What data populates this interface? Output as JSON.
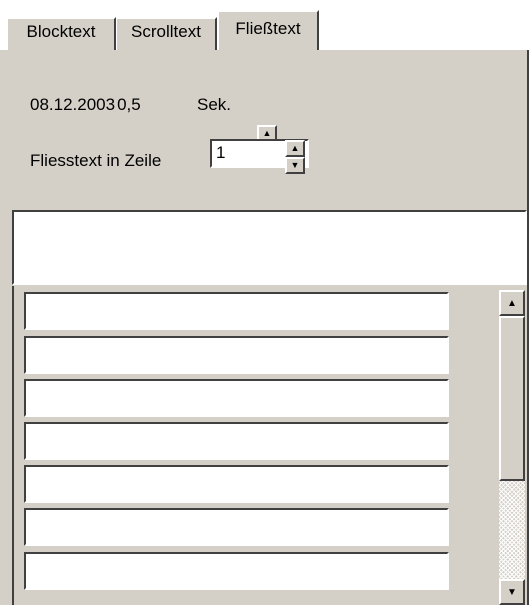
{
  "tabs": [
    {
      "label": "Blocktext"
    },
    {
      "label": "Scrolltext"
    },
    {
      "label": "Fließtext",
      "active": true
    }
  ],
  "settings": {
    "date": "08.12.2003",
    "seconds_value": "0,5",
    "seconds_unit": "Sek.",
    "line_label": "Fliesstext in Zeile",
    "line_value": "1"
  },
  "text_fields": [
    {
      "value": ""
    },
    {
      "value": ""
    },
    {
      "value": ""
    },
    {
      "value": ""
    },
    {
      "value": ""
    },
    {
      "value": ""
    },
    {
      "value": ""
    }
  ],
  "icons": {
    "spin_up": "▲",
    "spin_down": "▼",
    "scroll_up": "▲",
    "scroll_down": "▼"
  },
  "colors": {
    "panel": "#d4d0c8",
    "field": "#ffffff"
  }
}
